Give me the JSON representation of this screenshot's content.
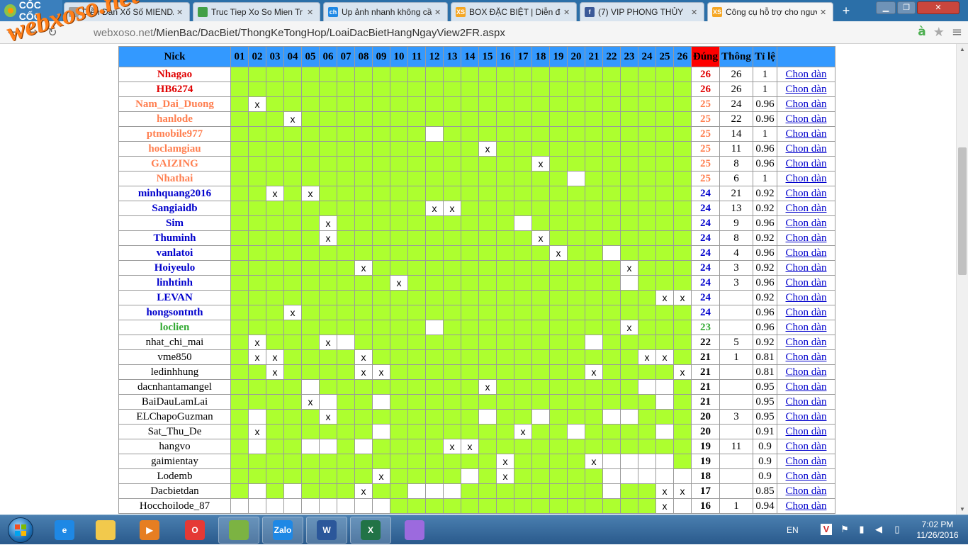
{
  "browser": {
    "brand_label": "CỐC CỐC",
    "tabs": [
      {
        "label": "Diễn Đàn Xổ Số MIENDA",
        "icon": "page-icon",
        "active": false
      },
      {
        "label": "Truc Tiep Xo So Mien Tr",
        "icon": "globe-icon",
        "active": false
      },
      {
        "label": "Up ảnh nhanh không cần",
        "icon": "ch-site-icon",
        "active": false
      },
      {
        "label": "BOX ĐẶC BIỆT | Diễn đàn",
        "icon": "xs-site-icon",
        "active": false
      },
      {
        "label": "(7) VIP PHONG THỦY",
        "icon": "facebook-icon",
        "active": false
      },
      {
        "label": "Công cụ hỗ trợ cho người",
        "icon": "xs-site-icon",
        "active": true
      }
    ],
    "new_tab_glyph": "+",
    "url_host": "webxoso.net",
    "url_path": "/MienBac/DacBiet/ThongKeTongHop/LoaiDacBietHangNgayView2FR.aspx",
    "watermark": "webxoso.net",
    "colors": {
      "tab_bar": "#2b6fa8",
      "header": "#3399ff",
      "cell_green": "#adff2f",
      "dung_header": "#ff0000"
    }
  },
  "table": {
    "headers": {
      "nick": "Nick",
      "dung": "Đúng",
      "thong": "Thông",
      "tile": "Tỉ lệ",
      "chon": ""
    },
    "days": [
      "01",
      "02",
      "03",
      "04",
      "05",
      "06",
      "07",
      "08",
      "09",
      "10",
      "11",
      "12",
      "13",
      "14",
      "15",
      "16",
      "17",
      "18",
      "19",
      "20",
      "21",
      "22",
      "23",
      "24",
      "25",
      "26"
    ],
    "rows": [
      {
        "nick": "Nhagao",
        "color": "#e00000",
        "bold": true,
        "x": [],
        "w": [],
        "dung": "26",
        "thong": "26",
        "tile": "1",
        "chon": "Chon dàn"
      },
      {
        "nick": "HB6274",
        "color": "#e00000",
        "bold": true,
        "x": [],
        "w": [],
        "dung": "26",
        "thong": "26",
        "tile": "1",
        "chon": "Chon dàn"
      },
      {
        "nick": "Nam_Dai_Duong",
        "color": "#ff7f50",
        "bold": true,
        "x": [
          2
        ],
        "w": [],
        "dung": "25",
        "thong": "24",
        "tile": "0.96",
        "chon": "Chon dàn"
      },
      {
        "nick": "hanlode",
        "color": "#ff7f50",
        "bold": true,
        "x": [
          4
        ],
        "w": [],
        "dung": "25",
        "thong": "22",
        "tile": "0.96",
        "chon": "Chon dàn"
      },
      {
        "nick": "ptmobile977",
        "color": "#ff7f50",
        "bold": true,
        "x": [],
        "w": [
          12
        ],
        "dung": "25",
        "thong": "14",
        "tile": "1",
        "chon": "Chon dàn"
      },
      {
        "nick": "hoclamgiau",
        "color": "#ff7f50",
        "bold": true,
        "x": [
          15
        ],
        "w": [],
        "dung": "25",
        "thong": "11",
        "tile": "0.96",
        "chon": "Chon dàn"
      },
      {
        "nick": "GAIZING",
        "color": "#ff7f50",
        "bold": true,
        "x": [
          18
        ],
        "w": [],
        "dung": "25",
        "thong": "8",
        "tile": "0.96",
        "chon": "Chon dàn"
      },
      {
        "nick": "Nhathai",
        "color": "#ff7f50",
        "bold": true,
        "x": [],
        "w": [
          20
        ],
        "dung": "25",
        "thong": "6",
        "tile": "1",
        "chon": "Chon dàn"
      },
      {
        "nick": "minhquang2016",
        "color": "#0000cc",
        "bold": true,
        "x": [
          3,
          5
        ],
        "w": [],
        "dung": "24",
        "thong": "21",
        "tile": "0.92",
        "chon": "Chon dàn"
      },
      {
        "nick": "Sangiaidb",
        "color": "#0000cc",
        "bold": true,
        "x": [
          12,
          13
        ],
        "w": [],
        "dung": "24",
        "thong": "13",
        "tile": "0.92",
        "chon": "Chon dàn"
      },
      {
        "nick": "Sim",
        "color": "#0000cc",
        "bold": true,
        "x": [
          6
        ],
        "w": [
          17
        ],
        "dung": "24",
        "thong": "9",
        "tile": "0.96",
        "chon": "Chon dàn"
      },
      {
        "nick": "Thuminh",
        "color": "#0000cc",
        "bold": true,
        "x": [
          6,
          18
        ],
        "w": [],
        "dung": "24",
        "thong": "8",
        "tile": "0.92",
        "chon": "Chon dàn"
      },
      {
        "nick": "vanlatoi",
        "color": "#0000cc",
        "bold": true,
        "x": [
          19
        ],
        "w": [
          22
        ],
        "dung": "24",
        "thong": "4",
        "tile": "0.96",
        "chon": "Chon dàn"
      },
      {
        "nick": "Hoiyeulo",
        "color": "#0000cc",
        "bold": true,
        "x": [
          8,
          23
        ],
        "w": [],
        "dung": "24",
        "thong": "3",
        "tile": "0.92",
        "chon": "Chon dàn"
      },
      {
        "nick": "linhtinh",
        "color": "#0000cc",
        "bold": true,
        "x": [
          10
        ],
        "w": [
          23
        ],
        "dung": "24",
        "thong": "3",
        "tile": "0.96",
        "chon": "Chon dàn"
      },
      {
        "nick": "LEVAN",
        "color": "#0000cc",
        "bold": true,
        "x": [
          25,
          26
        ],
        "w": [],
        "dung": "24",
        "thong": "",
        "tile": "0.92",
        "chon": "Chon dàn"
      },
      {
        "nick": "hongsontnth",
        "color": "#0000cc",
        "bold": true,
        "x": [
          4
        ],
        "w": [],
        "dung": "24",
        "thong": "",
        "tile": "0.96",
        "chon": "Chon dàn"
      },
      {
        "nick": "loclien",
        "color": "#33aa33",
        "bold": true,
        "x": [
          23
        ],
        "w": [
          12
        ],
        "dung": "23",
        "thong": "",
        "tile": "0.96",
        "chon": "Chon dàn"
      },
      {
        "nick": "nhat_chi_mai",
        "color": "#000000",
        "bold": false,
        "x": [
          2,
          6
        ],
        "w": [
          7,
          21
        ],
        "dung": "22",
        "thong": "5",
        "tile": "0.92",
        "chon": "Chon dàn"
      },
      {
        "nick": "vme850",
        "color": "#000000",
        "bold": false,
        "x": [
          2,
          3,
          8,
          24,
          25
        ],
        "w": [],
        "dung": "21",
        "thong": "1",
        "tile": "0.81",
        "chon": "Chon dàn"
      },
      {
        "nick": "ledinhhung",
        "color": "#000000",
        "bold": false,
        "x": [
          3,
          8,
          9,
          21,
          26
        ],
        "w": [],
        "dung": "21",
        "thong": "",
        "tile": "0.81",
        "chon": "Chon dàn"
      },
      {
        "nick": "dacnhantamangel",
        "color": "#000000",
        "bold": false,
        "x": [
          15
        ],
        "w": [
          5,
          24,
          25
        ],
        "dung": "21",
        "thong": "",
        "tile": "0.95",
        "chon": "Chon dàn"
      },
      {
        "nick": "BaiDauLamLai",
        "color": "#000000",
        "bold": false,
        "x": [
          5
        ],
        "w": [
          6,
          9,
          25
        ],
        "dung": "21",
        "thong": "",
        "tile": "0.95",
        "chon": "Chon dàn"
      },
      {
        "nick": "ELChapoGuzman",
        "color": "#000000",
        "bold": false,
        "x": [
          6
        ],
        "w": [
          2,
          15,
          18,
          22,
          23
        ],
        "dung": "20",
        "thong": "3",
        "tile": "0.95",
        "chon": "Chon dàn"
      },
      {
        "nick": "Sat_Thu_De",
        "color": "#000000",
        "bold": false,
        "x": [
          2,
          17
        ],
        "w": [
          9,
          20,
          25
        ],
        "dung": "20",
        "thong": "",
        "tile": "0.91",
        "chon": "Chon dàn"
      },
      {
        "nick": "hangvo",
        "color": "#000000",
        "bold": false,
        "x": [
          13,
          14
        ],
        "w": [
          2,
          5,
          6,
          8
        ],
        "dung": "19",
        "thong": "11",
        "tile": "0.9",
        "chon": "Chon dàn"
      },
      {
        "nick": "gaimientay",
        "color": "#000000",
        "bold": false,
        "x": [
          16,
          21
        ],
        "w": [
          22,
          23,
          24,
          25
        ],
        "dung": "19",
        "thong": "",
        "tile": "0.9",
        "chon": "Chon dàn"
      },
      {
        "nick": "Lodemb",
        "color": "#000000",
        "bold": false,
        "x": [
          9,
          16
        ],
        "w": [
          14,
          22,
          23,
          24,
          25,
          26
        ],
        "dung": "18",
        "thong": "",
        "tile": "0.9",
        "chon": "Chon dàn"
      },
      {
        "nick": "Dacbietdan",
        "color": "#000000",
        "bold": false,
        "x": [
          8,
          25,
          26
        ],
        "w": [
          2,
          4,
          11,
          12,
          13,
          22
        ],
        "dung": "17",
        "thong": "",
        "tile": "0.85",
        "chon": "Chon dàn"
      },
      {
        "nick": "Hocchoilode_87",
        "color": "#000000",
        "bold": false,
        "x": [
          25
        ],
        "w": [
          1,
          2,
          3,
          4,
          5,
          6,
          7,
          8,
          9,
          26
        ],
        "dung": "16",
        "thong": "1",
        "tile": "0.94",
        "chon": "Chon dàn"
      }
    ]
  },
  "taskbar": {
    "apps": [
      {
        "name": "internet-explorer-icon",
        "label": "e",
        "color": "#1e88e5",
        "pinned": false
      },
      {
        "name": "file-explorer-icon",
        "label": "",
        "color": "#f2c94c",
        "pinned": false
      },
      {
        "name": "media-player-icon",
        "label": "▶",
        "color": "#e67e22",
        "pinned": false
      },
      {
        "name": "opera-icon",
        "label": "O",
        "color": "#e53935",
        "pinned": false
      },
      {
        "name": "coc-coc-icon",
        "label": "",
        "color": "#7cb342",
        "pinned": true
      },
      {
        "name": "zalo-icon",
        "label": "Zalo",
        "color": "#1e88e5",
        "pinned": true
      },
      {
        "name": "word-icon",
        "label": "W",
        "color": "#2b579a",
        "pinned": true
      },
      {
        "name": "excel-icon",
        "label": "X",
        "color": "#217346",
        "pinned": true
      },
      {
        "name": "paint-icon",
        "label": "",
        "color": "#9c6ade",
        "pinned": false
      }
    ],
    "language": "EN",
    "time": "7:02 PM",
    "date": "11/26/2016"
  }
}
